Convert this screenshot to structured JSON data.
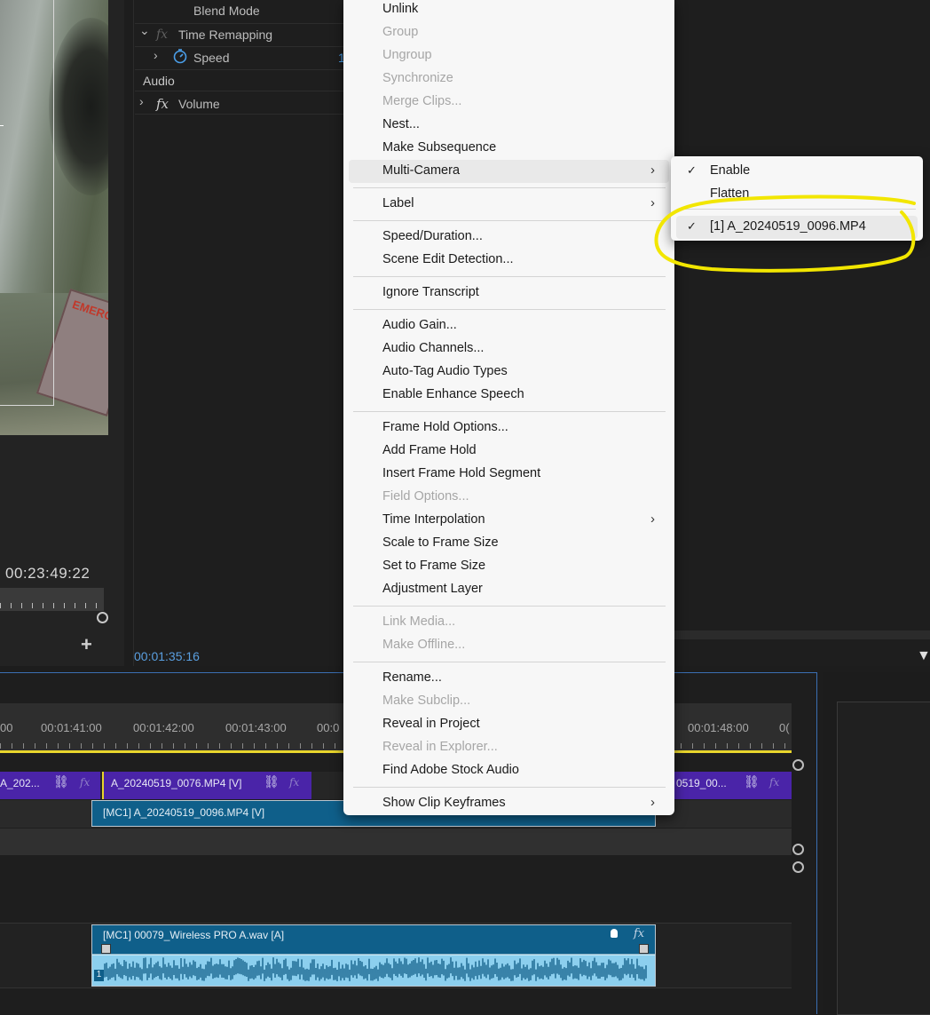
{
  "monitor": {
    "timecode": "00:23:49:22",
    "add_glyph": "+"
  },
  "effect_controls": {
    "blend_mode": "Blend Mode",
    "time_remapping": "Time Remapping",
    "speed": "Speed",
    "speed_value_partial": "1",
    "audio_header": "Audio",
    "volume": "Volume",
    "fx_glyph": "fx",
    "expand_glyph": "›",
    "collapse_glyph": "⌄",
    "current_time": "00:01:35:16"
  },
  "timeline": {
    "ruler_labels": [
      "00",
      "00:01:41:00",
      "00:01:42:00",
      "00:01:43:00",
      "00:0",
      "00:01:48:00",
      "0("
    ],
    "clip_v_left": "A_202...",
    "clip_v_mid": "A_20240519_0076.MP4 [V]",
    "clip_v_right": "0519_00...",
    "mc_video_label": "[MC1] A_20240519_0096.MP4 [V]",
    "mc_audio_label": "[MC1] 00079_Wireless PRO A.wav [A]",
    "audio_channel_num": "1",
    "fx_glyph": "fx",
    "link_glyph": "⛓"
  },
  "context_menu": {
    "items": [
      {
        "label": "Unlink",
        "enabled": true
      },
      {
        "label": "Group",
        "enabled": false
      },
      {
        "label": "Ungroup",
        "enabled": false
      },
      {
        "label": "Synchronize",
        "enabled": false
      },
      {
        "label": "Merge Clips...",
        "enabled": false
      },
      {
        "label": "Nest...",
        "enabled": true
      },
      {
        "label": "Make Subsequence",
        "enabled": true
      },
      {
        "label": "Multi-Camera",
        "enabled": true,
        "submenu": true
      },
      {
        "label": "Label",
        "enabled": true,
        "submenu": true
      },
      {
        "label": "Speed/Duration...",
        "enabled": true
      },
      {
        "label": "Scene Edit Detection...",
        "enabled": true
      },
      {
        "label": "Ignore Transcript",
        "enabled": true
      },
      {
        "label": "Audio Gain...",
        "enabled": true
      },
      {
        "label": "Audio Channels...",
        "enabled": true
      },
      {
        "label": "Auto-Tag Audio Types",
        "enabled": true
      },
      {
        "label": "Enable Enhance Speech",
        "enabled": true
      },
      {
        "label": "Frame Hold Options...",
        "enabled": true
      },
      {
        "label": "Add Frame Hold",
        "enabled": true
      },
      {
        "label": "Insert Frame Hold Segment",
        "enabled": true
      },
      {
        "label": "Field Options...",
        "enabled": false
      },
      {
        "label": "Time Interpolation",
        "enabled": true,
        "submenu": true
      },
      {
        "label": "Scale to Frame Size",
        "enabled": true
      },
      {
        "label": "Set to Frame Size",
        "enabled": true
      },
      {
        "label": "Adjustment Layer",
        "enabled": true
      },
      {
        "label": "Link Media...",
        "enabled": false
      },
      {
        "label": "Make Offline...",
        "enabled": false
      },
      {
        "label": "Rename...",
        "enabled": true
      },
      {
        "label": "Make Subclip...",
        "enabled": false
      },
      {
        "label": "Reveal in Project",
        "enabled": true
      },
      {
        "label": "Reveal in Explorer...",
        "enabled": false
      },
      {
        "label": "Find Adobe Stock Audio",
        "enabled": true
      },
      {
        "label": "Show Clip Keyframes",
        "enabled": true,
        "submenu": true
      }
    ],
    "submenu_arrow": "›"
  },
  "multicam_submenu": {
    "items": [
      {
        "label": "Enable",
        "checked": true
      },
      {
        "label": "Flatten",
        "checked": false
      },
      {
        "label": "[1] A_20240519_0096.MP4",
        "checked": true
      }
    ],
    "check_glyph": "✓"
  },
  "colors": {
    "menu_bg": "#f7f7f7",
    "clip_purple": "#4a24a8",
    "clip_blue": "#0f5f8a",
    "annotation_yellow": "#f2e600",
    "playhead_bar": "#e8d52c",
    "timecode_blue": "#5a9fe0"
  }
}
